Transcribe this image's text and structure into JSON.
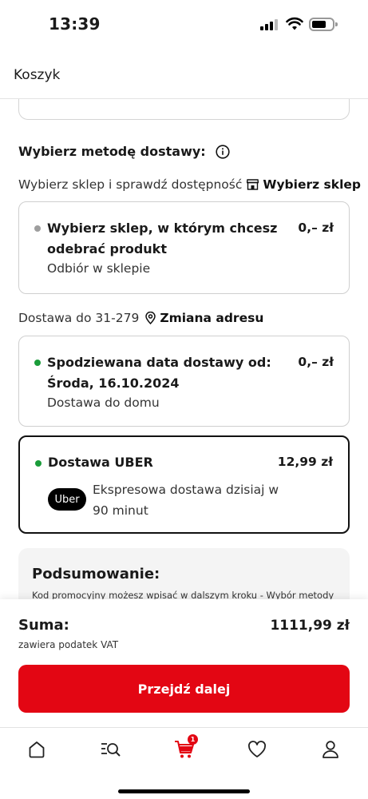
{
  "status_bar": {
    "time": "13:39"
  },
  "header": {
    "title": "Koszyk"
  },
  "delivery": {
    "section_title": "Wybierz metodę dostawy:",
    "store_prompt": "Wybierz sklep i sprawdź dostępność",
    "store_link": "Wybierz sklep",
    "address_prompt": "Dostawa do 31-279",
    "address_link": "Zmiana adresu",
    "options": [
      {
        "title": "Wybierz sklep, w którym chcesz odebrać produkt",
        "subtitle": "Odbiór w sklepie",
        "price": "0,– zł",
        "dot_color": "#9e9e9e",
        "selected": false
      },
      {
        "title": "Spodziewana data dostawy od: Środa, 16.10.2024",
        "subtitle": "Dostawa do domu",
        "price": "0,– zł",
        "dot_color": "#1a9c3a",
        "selected": false
      },
      {
        "title": "Dostawa UBER",
        "badge": "Uber",
        "subtitle": "Ekspresowa dostawa dzisiaj w 90 minut",
        "price": "12,99 zł",
        "dot_color": "#1a9c3a",
        "selected": true
      }
    ]
  },
  "summary": {
    "title": "Podsumowanie:",
    "text": "Kod promocyjny możesz wpisać w dalszym kroku - Wybór metody"
  },
  "footer": {
    "sum_label": "Suma:",
    "sum_sub": "zawiera podatek VAT",
    "sum_value": "1111,99 zł",
    "cta_label": "Przejdź dalej"
  },
  "tabbar": {
    "items": [
      "home-icon",
      "search-icon",
      "cart-icon",
      "heart-icon",
      "profile-icon"
    ],
    "cart_count": "1",
    "accent": "#e30613"
  }
}
